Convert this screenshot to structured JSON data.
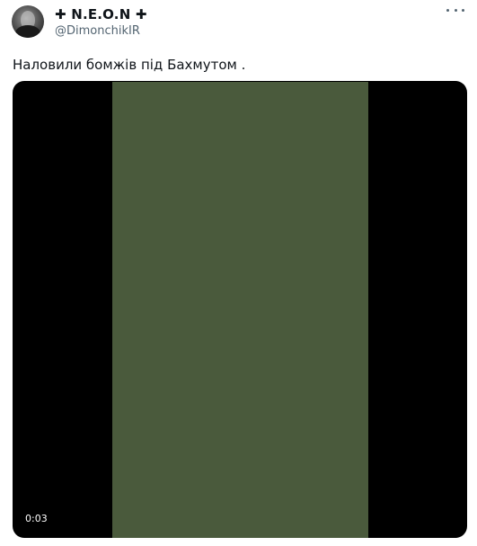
{
  "tweet": {
    "display_name": "✚ N.E.O.N ✚",
    "handle": "@DimonchikIR",
    "text": "Наловили бомжів під Бахмутом ."
  },
  "media": {
    "timestamp": "0:03"
  },
  "icons": {
    "more": "more-dots-icon"
  },
  "colors": {
    "text_primary": "#0f1419",
    "text_secondary": "#536471",
    "media_background": "#000000"
  }
}
